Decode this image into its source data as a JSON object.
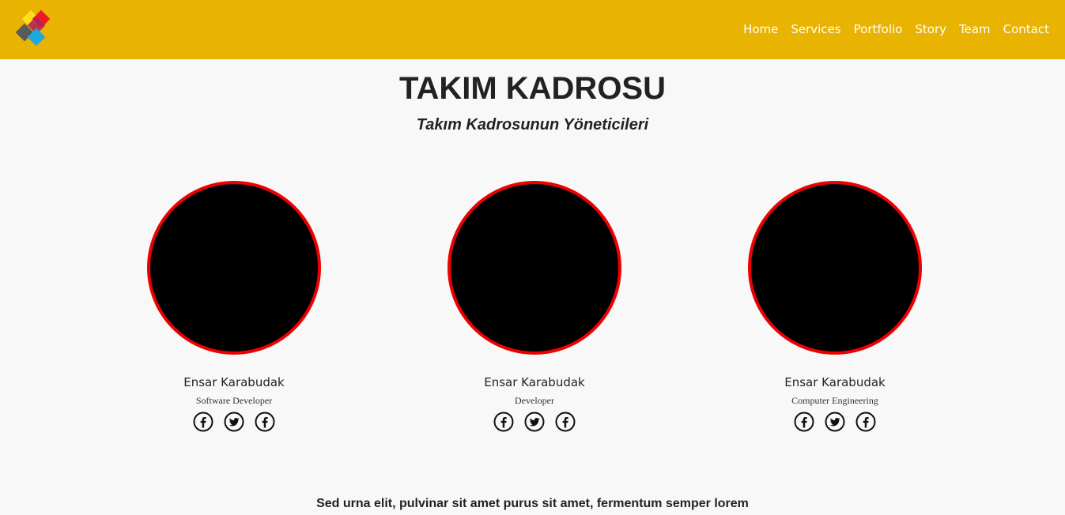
{
  "brand": {
    "logo_colors": [
      "#ffde17",
      "#ed1c24",
      "#5a5a5a",
      "#1ba9e1"
    ],
    "navbar_color": "#e9b301"
  },
  "nav": {
    "items": [
      {
        "label": "Home"
      },
      {
        "label": "Services"
      },
      {
        "label": "Portfolio"
      },
      {
        "label": "Story"
      },
      {
        "label": "Team"
      },
      {
        "label": "Contact"
      }
    ]
  },
  "section": {
    "title": "TAKIM KADROSU",
    "subtitle": "Takım Kadrosunun Yöneticileri"
  },
  "team": [
    {
      "name": "Ensar Karabudak",
      "role": "Software Developer",
      "socials": [
        "facebook-icon",
        "twitter-icon",
        "facebook-icon"
      ]
    },
    {
      "name": "Ensar Karabudak",
      "role": "Developer",
      "socials": [
        "facebook-icon",
        "twitter-icon",
        "facebook-icon"
      ]
    },
    {
      "name": "Ensar Karabudak",
      "role": "Computer Engineering",
      "socials": [
        "facebook-icon",
        "twitter-icon",
        "facebook-icon"
      ]
    }
  ],
  "photo_border_color": "#ee0000",
  "footer": {
    "text": "Sed urna elit, pulvinar sit amet purus sit amet, fermentum semper lorem"
  }
}
